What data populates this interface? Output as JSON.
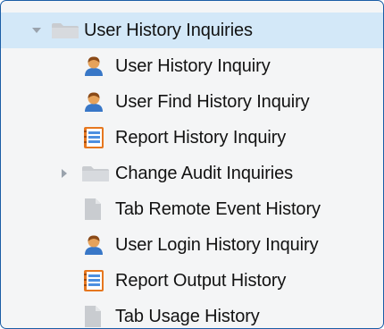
{
  "tree": {
    "root": {
      "label": "User History Inquiries",
      "icon": "folder-icon",
      "expanded": true
    },
    "items": [
      {
        "label": "User History Inquiry",
        "icon": "user-icon"
      },
      {
        "label": "User Find History Inquiry",
        "icon": "user-icon"
      },
      {
        "label": "Report History Inquiry",
        "icon": "report-icon"
      },
      {
        "label": "Change Audit Inquiries",
        "icon": "folder-icon",
        "expanded": false
      },
      {
        "label": "Tab Remote Event History",
        "icon": "document-icon"
      },
      {
        "label": "User Login History Inquiry",
        "icon": "user-icon"
      },
      {
        "label": "Report Output History",
        "icon": "report-icon"
      },
      {
        "label": "Tab Usage History",
        "icon": "document-icon"
      }
    ]
  },
  "colors": {
    "selected_row": "#d3e8f8",
    "border": "#1a5da6",
    "text": "#121212",
    "folder": "#c9ccd0",
    "user_head": "#e6a25a",
    "user_body": "#3877c7",
    "report_orange": "#e6771f",
    "report_blue": "#4d8fe0"
  }
}
